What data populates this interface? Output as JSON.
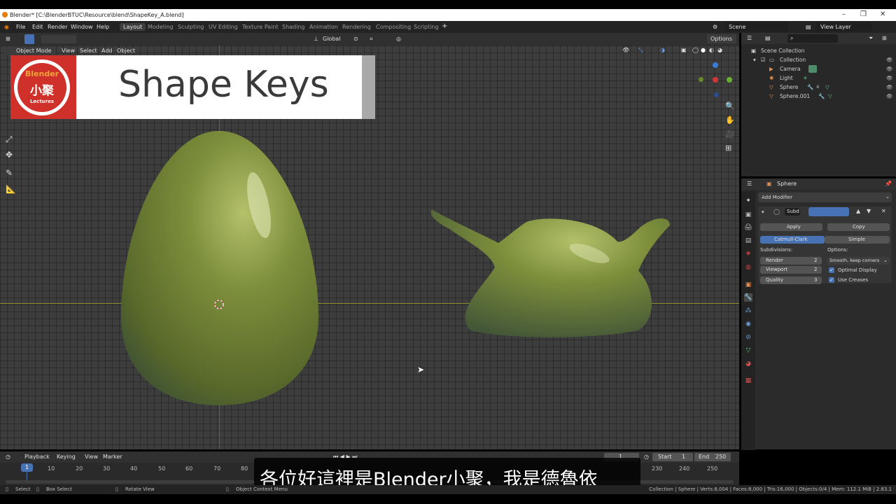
{
  "window": {
    "title": "Blender* [C:\\BlenderBTUC\\Resource\\blend\\ShapeKey_A.blend]"
  },
  "menu": [
    "File",
    "Edit",
    "Render",
    "Window",
    "Help"
  ],
  "workspaces": [
    "Layout",
    "Modeling",
    "Sculpting",
    "UV Editing",
    "Texture Paint",
    "Shading",
    "Animation",
    "Rendering",
    "Compositing",
    "Scripting"
  ],
  "scene": {
    "label": "Scene",
    "view_layer": "View Layer"
  },
  "viewport_header": {
    "mode": "Object Mode",
    "view": "View",
    "select": "Select",
    "add": "Add",
    "object": "Object",
    "orientation": "Global",
    "options": "Options"
  },
  "banner": {
    "title": "Shape Keys",
    "logo_top": "Blender",
    "logo_cn": "小聚",
    "logo_bottom": "Lectures"
  },
  "outliner": {
    "root": "Scene Collection",
    "collection": "Collection",
    "items": [
      "Camera",
      "Light",
      "Sphere",
      "Sphere.001"
    ]
  },
  "properties": {
    "object_name": "Sphere",
    "add_modifier": "Add Modifier",
    "modifier_name": "Subd",
    "apply": "Apply",
    "copy": "Copy",
    "catmull": "Catmull-Clark",
    "simple": "Simple",
    "subdivisions_label": "Subdivisions:",
    "options_label": "Options:",
    "render_label": "Render",
    "render_value": "2",
    "viewport_label": "Viewport",
    "viewport_value": "2",
    "quality_label": "Quality",
    "quality_value": "3",
    "uv_smooth": "Smooth, keep corners",
    "optimal_display": "Optimal Display",
    "use_creases": "Use Creases"
  },
  "timeline": {
    "playback": "Playback",
    "keying": "Keying",
    "view": "View",
    "marker": "Marker",
    "current_frame": "1",
    "start_label": "Start",
    "start": "1",
    "end_label": "End",
    "end": "250",
    "ticks": [
      "10",
      "20",
      "30",
      "40",
      "50",
      "60",
      "70",
      "80",
      "230",
      "240",
      "250"
    ]
  },
  "status": {
    "select": "Select",
    "box_select": "Box Select",
    "rotate_view": "Rotate View",
    "context_menu": "Object Context Menu",
    "stats": "Collection | Sphere | Verts:8,004 | Faces:8,000 | Tris:16,000 | Objects:0/4 | Mem: 112.1 MiB | 2.83.1"
  },
  "subtitle": "各位好這裡是Blender小聚，我是德魯依",
  "colors": {
    "accent": "#4772b3",
    "object": "#7a8d3c",
    "banner_red": "#d0302a",
    "x_axis": "#8a8a2a",
    "y_axis": "#3b5dbb"
  }
}
